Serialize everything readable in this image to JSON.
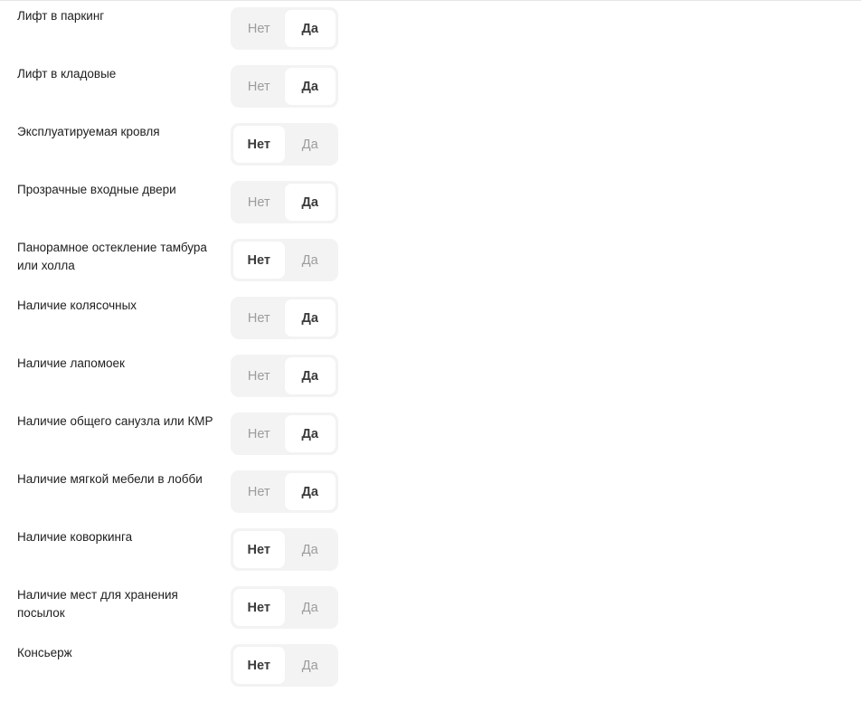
{
  "options": {
    "no": "Нет",
    "yes": "Да"
  },
  "rows": [
    {
      "id": "parking-lift",
      "label": "Лифт в паркинг",
      "value": "yes"
    },
    {
      "id": "storage-lift",
      "label": "Лифт в кладовые",
      "value": "yes"
    },
    {
      "id": "usable-roof",
      "label": "Эксплуатируемая кровля",
      "value": "no"
    },
    {
      "id": "glass-entry-doors",
      "label": "Прозрачные входные двери",
      "value": "yes"
    },
    {
      "id": "panoramic-glazing",
      "label": "Панорамное остекление тамбура или холла",
      "value": "no"
    },
    {
      "id": "stroller-rooms",
      "label": "Наличие колясочных",
      "value": "yes"
    },
    {
      "id": "pet-wash",
      "label": "Наличие лапомоек",
      "value": "yes"
    },
    {
      "id": "public-restroom",
      "label": "Наличие общего санузла или КМР",
      "value": "yes"
    },
    {
      "id": "lobby-furniture",
      "label": "Наличие мягкой мебели в лобби",
      "value": "yes"
    },
    {
      "id": "coworking",
      "label": "Наличие коворкинга",
      "value": "no"
    },
    {
      "id": "parcel-storage",
      "label": "Наличие мест для хранения посылок",
      "value": "no"
    },
    {
      "id": "concierge",
      "label": "Консьерж",
      "value": "no"
    }
  ]
}
